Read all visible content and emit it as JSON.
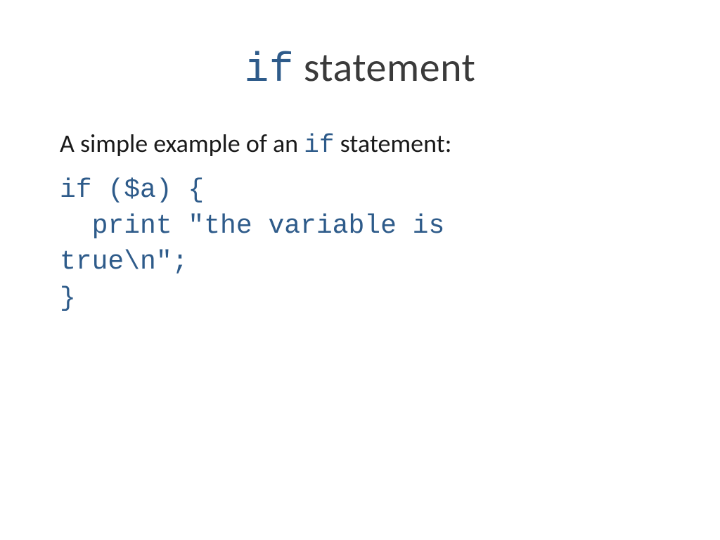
{
  "title": {
    "keyword": "if",
    "rest": " statement"
  },
  "intro": {
    "prefix": "A simple example of an ",
    "keyword": "if",
    "suffix": " statement:"
  },
  "code": {
    "line1": "if ($a) {",
    "line2": "  print \"the variable is",
    "line3": "true\\n\";",
    "line4": "}"
  }
}
